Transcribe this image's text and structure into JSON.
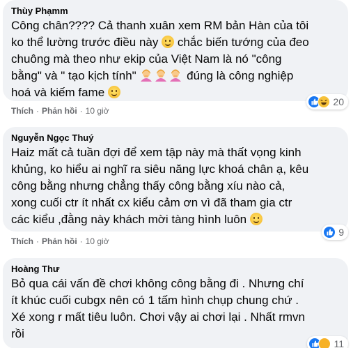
{
  "comments": [
    {
      "author": "Thùy Phạmm",
      "line1": "Công chân???? Cả thanh xuân xem RM bản Hàn của tôi",
      "line2": "ko thể lường trước điều này ",
      "line2b": " chắc biến tướng của đeo",
      "line3": "chuông mà theo như ekip của Việt Nam là nó \"công",
      "line4a": "bằng\" và \" tạo kịch tính\" ",
      "line4b": " đúng là công nghiệp",
      "line5": "hoá và kiếm fame ",
      "like_label": "Thích",
      "reply_label": "Phản hồi",
      "time": "10 giờ",
      "reaction_count": "20"
    },
    {
      "author": "Nguyễn Ngọc Thuý",
      "line1": "Haiz mất cả tuần đợi để xem tập này mà thất vọng kinh",
      "line2": "khủng, ko hiểu ai nghĩ ra siêu năng lực khoá chân ạ, kêu",
      "line3": "công bằng nhưng chẳng thấy công bằng xíu nào cả,",
      "line4": "xong cuối ctr ít nhất cx kiểu cảm ơn vì đã tham gia ctr",
      "line5": "các kiểu ,đằng này khách mời tàng hình luôn ",
      "like_label": "Thích",
      "reply_label": "Phản hồi",
      "time": "10 giờ",
      "reaction_count": "9"
    },
    {
      "author": "Hoàng Thư",
      "line1": "Bỏ qua cái vấn đề chơi không công bằng đi . Nhưng chí",
      "line2": "ít khúc cuối cubgx nên có 1 tấm hình chụp chung chứ .",
      "line3": "Xé xong r mất tiêu luôn. Chơi vậy ai chơi lại . Nhất rmvn",
      "line4": "rồi",
      "reaction_count": "11"
    }
  ],
  "colors": {
    "bubble": "#f0f2f5",
    "meta": "#65676b",
    "like": "#1877f2",
    "haha": "#f7c23a",
    "care": "#f7b125"
  },
  "icons": [
    "smile-emoji",
    "woman-facepalming-emoji",
    "like-reaction-icon",
    "haha-reaction-icon",
    "care-reaction-icon"
  ]
}
